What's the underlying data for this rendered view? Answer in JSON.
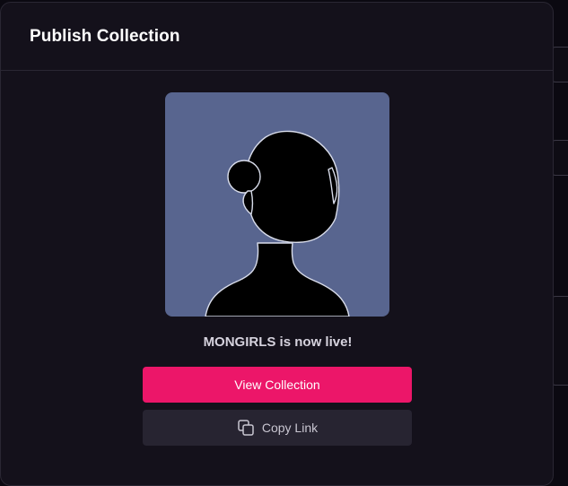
{
  "modal": {
    "title": "Publish Collection"
  },
  "avatar": {
    "icon": "person-silhouette-icon",
    "background_color": "#58658f"
  },
  "status": {
    "message": "MONGIRLS is now live!"
  },
  "actions": {
    "view_collection_label": "View Collection",
    "copy_link_label": "Copy Link",
    "copy_icon": "copy-icon",
    "primary_color": "#ec1669",
    "secondary_color": "#272431"
  }
}
